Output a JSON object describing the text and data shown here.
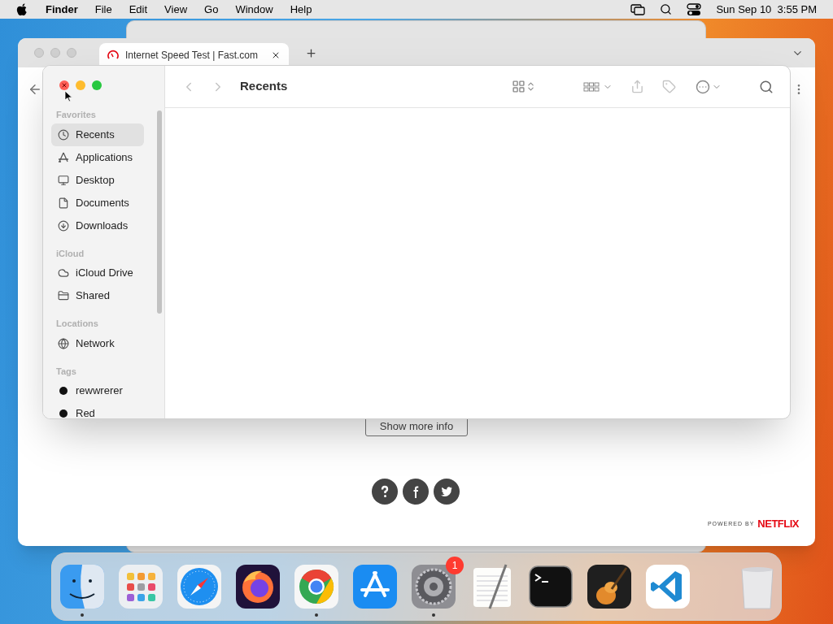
{
  "menu_bar": {
    "app": "Finder",
    "menus": [
      "File",
      "Edit",
      "View",
      "Go",
      "Window",
      "Help"
    ],
    "clock": "Sun Sep 10  3:55 PM"
  },
  "browser": {
    "tabs": [
      {
        "title": "Internet Speed Test | Fast.com",
        "selected": true
      }
    ],
    "more_info_button": "Show more info",
    "footer": {
      "powered_by": "POWERED BY",
      "brand": "NETFLIX"
    }
  },
  "finder": {
    "title": "Recents",
    "sidebar": [
      {
        "heading": "Favorites",
        "items": [
          {
            "label": "Recents",
            "kind": "clock",
            "selected": true
          },
          {
            "label": "Applications",
            "kind": "apps",
            "selected": false
          },
          {
            "label": "Desktop",
            "kind": "desktop",
            "selected": false
          },
          {
            "label": "Documents",
            "kind": "document",
            "selected": false
          },
          {
            "label": "Downloads",
            "kind": "download",
            "selected": false
          }
        ]
      },
      {
        "heading": "iCloud",
        "items": [
          {
            "label": "iCloud Drive",
            "kind": "cloud",
            "selected": false
          },
          {
            "label": "Shared",
            "kind": "shared",
            "selected": false
          }
        ]
      },
      {
        "heading": "Locations",
        "items": [
          {
            "label": "Network",
            "kind": "network",
            "selected": false
          }
        ]
      },
      {
        "heading": "Tags",
        "items": [
          {
            "label": "rewwrerer",
            "kind": "tag",
            "color": "#111111",
            "selected": false
          },
          {
            "label": "Red",
            "kind": "tag",
            "color": "#111111",
            "selected": false
          }
        ]
      }
    ]
  },
  "dock": {
    "items": [
      {
        "kind": "finder",
        "running": true
      },
      {
        "kind": "launchpad",
        "running": false
      },
      {
        "kind": "safari",
        "running": false
      },
      {
        "kind": "firefox",
        "running": false
      },
      {
        "kind": "chrome",
        "running": true
      },
      {
        "kind": "appstore",
        "running": false
      },
      {
        "kind": "settings",
        "running": true,
        "badge": "1"
      },
      {
        "kind": "textedit",
        "running": false
      },
      {
        "kind": "terminal",
        "running": false
      },
      {
        "kind": "garageband",
        "running": false
      },
      {
        "kind": "vscode",
        "running": false
      },
      {
        "kind": "trash",
        "running": false
      }
    ]
  }
}
